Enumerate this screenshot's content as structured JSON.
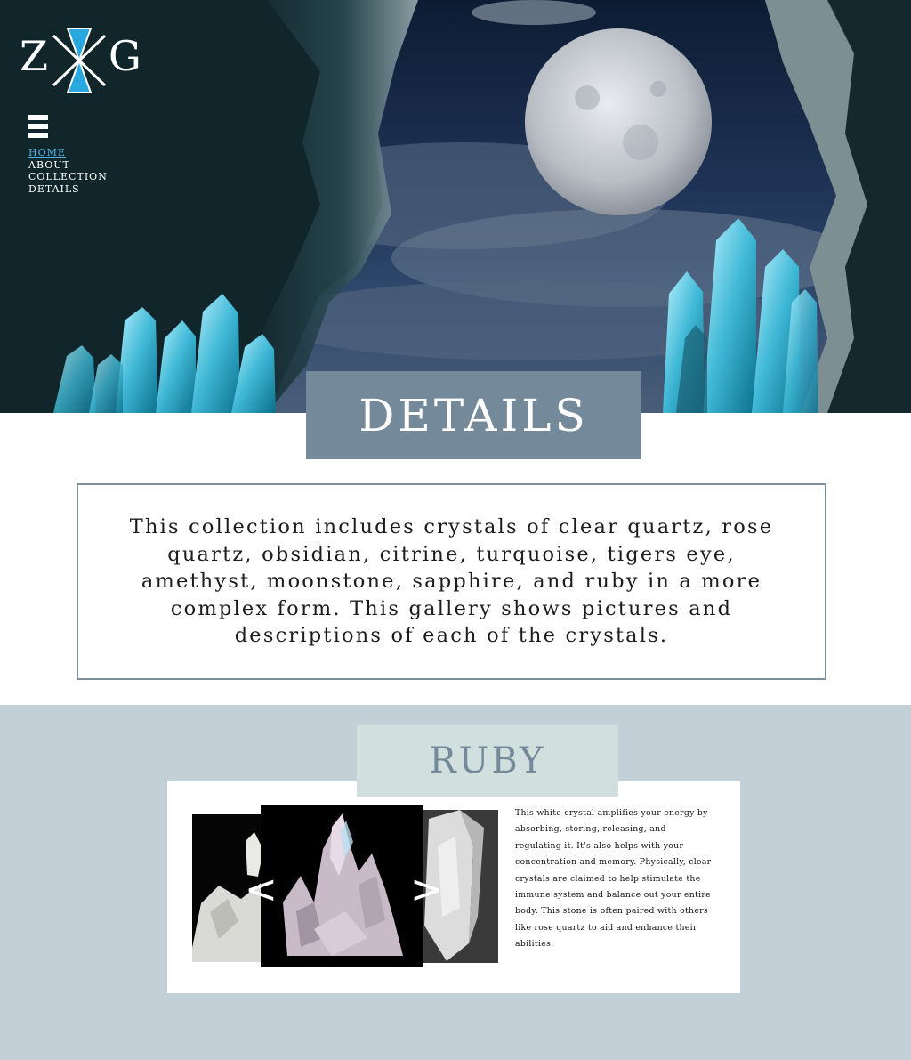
{
  "logo": {
    "left_letter": "Z",
    "right_letter": "G"
  },
  "nav": {
    "items": [
      {
        "label": "HOME",
        "active": true
      },
      {
        "label": "ABOUT",
        "active": false
      },
      {
        "label": "COLLECTION",
        "active": false
      },
      {
        "label": "DETAILS",
        "active": false
      }
    ]
  },
  "hero": {
    "title": "DETAILS"
  },
  "intro": {
    "text": "This collection includes crystals of clear quartz, rose quartz, obsidian, citrine, turquoise, tigers eye, amethyst, moonstone, sapphire, and ruby in a more complex form. This gallery shows pictures and descriptions of each of the crystals."
  },
  "gallery": {
    "title": "RUBY",
    "prev_arrow": "<",
    "next_arrow": ">",
    "description": "This white crystal amplifies your energy by absorbing, storing, releasing, and regulating it. It's also helps with your concentration and memory. Physically, clear crystals are claimed to help stimulate the immune system and balance out your entire body. This stone is often paired with others like rose quartz to aid and enhance their abilities."
  },
  "colors": {
    "banner": "#74899a",
    "gallery_bg": "#c3d0d8",
    "ruby_banner": "#d1dfdf",
    "nav_active": "#4fb4e6",
    "logo_accent": "#29a8e0"
  }
}
